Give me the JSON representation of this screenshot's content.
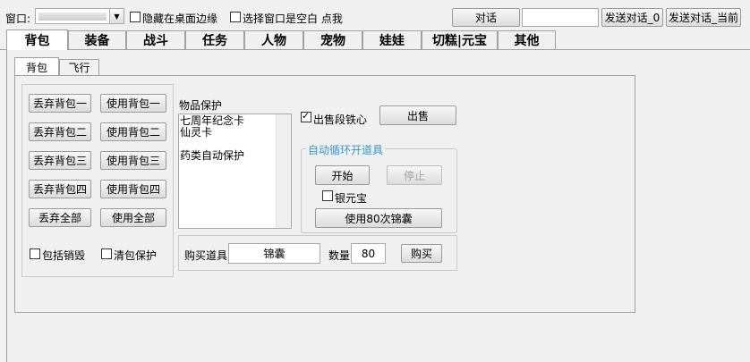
{
  "topbar": {
    "window_label": "窗口:",
    "window_select_value": "",
    "hide_edge_label": "隐藏在桌面边缘",
    "blank_window_label": "选择窗口是空白 点我",
    "dialog_button": "对话",
    "dialog_input_value": "",
    "send_dialog_0": "发送对话_0",
    "send_dialog_current": "发送对话_当前"
  },
  "tabs": [
    "背包",
    "装备",
    "战斗",
    "任务",
    "人物",
    "宠物",
    "娃娃",
    "切糕|元宝",
    "其他"
  ],
  "subtabs": [
    "背包",
    "飞行"
  ],
  "backpack": {
    "buttons": {
      "discard_1": "丢弃背包一",
      "use_1": "使用背包一",
      "discard_2": "丢弃背包二",
      "use_2": "使用背包二",
      "discard_3": "丢弃背包三",
      "use_3": "使用背包三",
      "discard_4": "丢弃背包四",
      "use_4": "使用背包四",
      "discard_all": "丢弃全部",
      "use_all": "使用全部"
    },
    "include_destroy_label": "包括销毁",
    "clear_protect_label": "清包保护",
    "protect_title": "物品保护",
    "protect_items": [
      "七周年纪念卡",
      "仙灵卡",
      "",
      "药类自动保护"
    ],
    "sell_iron_label": "出售段铁心",
    "sell_iron_checked": true,
    "sell_button": "出售",
    "auto_group_title": "自动循环开道具",
    "start_button": "开始",
    "stop_button": "停止",
    "silver_label": "银元宝",
    "use80_button": "使用80次锦囊",
    "buy_label": "购买道具",
    "buy_item_value": "锦囊",
    "qty_label": "数量",
    "qty_value": "80",
    "buy_button": "购买"
  },
  "colors": {
    "group_title": "#3399cc"
  }
}
